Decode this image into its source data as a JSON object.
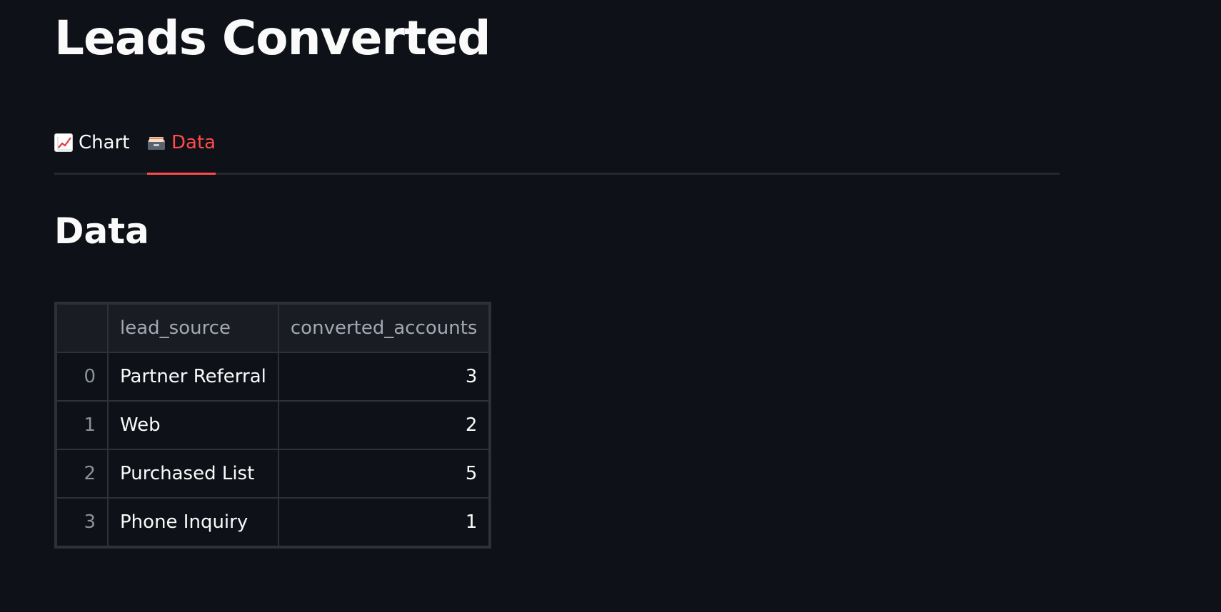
{
  "page": {
    "title": "Leads Converted"
  },
  "tabs": [
    {
      "label": "Chart",
      "icon": "chart-increasing-icon",
      "active": false
    },
    {
      "label": "Data",
      "icon": "card-index-icon",
      "active": true
    }
  ],
  "colors": {
    "background": "#0e1117",
    "active_tab": "#ff4b4b",
    "table_border": "#2f3138",
    "header_bg": "#1a1c24"
  },
  "data_section": {
    "title": "Data",
    "table": {
      "columns": [
        "",
        "lead_source",
        "converted_accounts"
      ],
      "rows": [
        {
          "index": "0",
          "lead_source": "Partner Referral",
          "converted_accounts": "3"
        },
        {
          "index": "1",
          "lead_source": "Web",
          "converted_accounts": "2"
        },
        {
          "index": "2",
          "lead_source": "Purchased List",
          "converted_accounts": "5"
        },
        {
          "index": "3",
          "lead_source": "Phone Inquiry",
          "converted_accounts": "1"
        }
      ]
    }
  }
}
